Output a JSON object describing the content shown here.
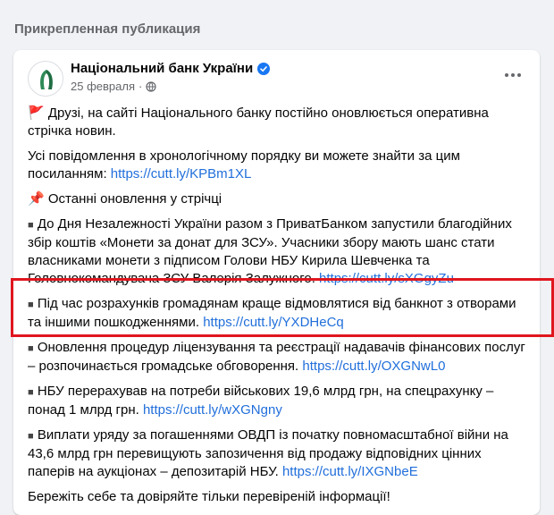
{
  "section": {
    "title": "Прикрепленная публикация"
  },
  "post": {
    "author": "Національний банк України",
    "date": "25 февраля",
    "separator": "·",
    "paragraphs": [
      {
        "icon": "🚩",
        "text": "Друзі, на сайті Національного банку постійно оновлюється оперативна стрічка новин.",
        "link": ""
      },
      {
        "icon": "",
        "text": "Усі повідомлення в хронологічному порядку ви можете знайти за цим посиланням: ",
        "link": "https://cutt.ly/KPBm1XL"
      },
      {
        "icon": "📌",
        "text": "Останні оновлення у стрічці",
        "link": ""
      },
      {
        "icon": "■",
        "text": "До Дня Незалежності України разом з ПриватБанком запустили благодійних збір коштів «Монети за донат для ЗСУ». Учасники збору мають шанс стати власниками монети з підписом Голови НБУ Кирила Шевченка та Головнокомандувача ЗСУ Валерія Залужного. ",
        "link": "https://cutt.ly/sXGgyZu"
      },
      {
        "icon": "■",
        "text": "Під час розрахунків громадянам краще відмовлятися від банкнот з отворами та іншими пошкодженнями. ",
        "link": "https://cutt.ly/YXDHeCq"
      },
      {
        "icon": "■",
        "text": "Оновлення процедур ліцензування та реєстрації надавачів фінансових послуг – розпочинається громадське обговорення. ",
        "link": "https://cutt.ly/OXGNwL0"
      },
      {
        "icon": "■",
        "text": "НБУ перерахував на потреби військових 19,6 млрд грн, на спецрахунку – понад 1 млрд грн. ",
        "link": "https://cutt.ly/wXGNgny"
      },
      {
        "icon": "■",
        "text": "Виплати уряду за погашеннями ОВДП із початку повномасштабної війни на 43,6 млрд грн перевищують запозичення від продажу відповідних цінних паперів на аукціонах – депозитарій НБУ. ",
        "link": "https://cutt.ly/IXGNbeE"
      },
      {
        "icon": "",
        "text": "Бережіть себе та довіряйте тільки перевіреній інформації!",
        "link": ""
      }
    ]
  },
  "colors": {
    "link": "#216fdb",
    "highlight": "#e0161e",
    "verified": "#1877f2"
  },
  "icons": {
    "verified": "verified-badge-icon",
    "privacy": "globe-icon",
    "more": "more-options-icon"
  }
}
